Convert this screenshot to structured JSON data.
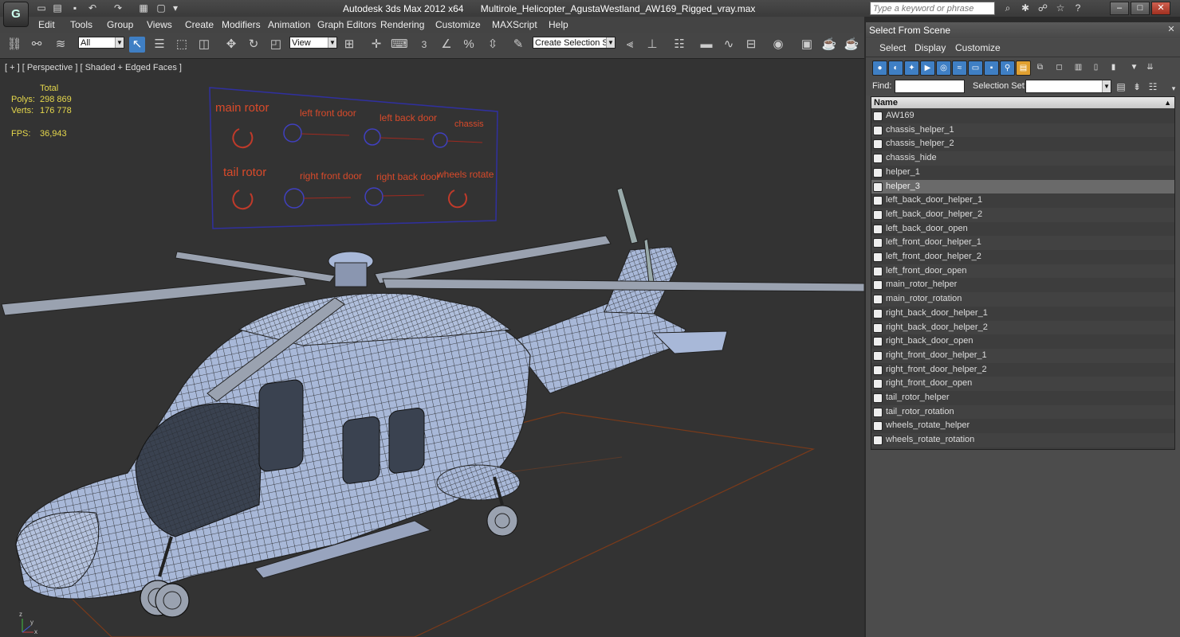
{
  "app": {
    "title": "Autodesk 3ds Max  2012 x64",
    "file": "Multirole_Helicopter_AgustaWestland_AW169_Rigged_vray.max",
    "logo_glyph": "G",
    "search_placeholder": "Type a keyword or phrase"
  },
  "menu": [
    "Edit",
    "Tools",
    "Group",
    "Views",
    "Create",
    "Modifiers",
    "Animation",
    "Graph Editors",
    "Rendering",
    "Customize",
    "MAXScript",
    "Help"
  ],
  "toolbar": {
    "filter_value": "All",
    "refcoord_value": "View",
    "selset_value": "Create Selection Se",
    "snap_label": "3"
  },
  "viewport": {
    "label": "[ + ] [ Perspective ] [ Shaded + Edged Faces ]",
    "stats": {
      "total_label": "Total",
      "polys_label": "Polys:",
      "polys_value": "298 869",
      "verts_label": "Verts:",
      "verts_value": "176 778",
      "fps_label": "FPS:",
      "fps_value": "36,943"
    },
    "control_board": {
      "main_rotor": "main rotor",
      "left_front_door": "left front door",
      "left_back_door": "left back door",
      "chassis": "chassis",
      "tail_rotor": "tail rotor",
      "right_front_door": "right front door",
      "right_back_door": "right back door",
      "wheels_rotate": "wheels rotate"
    },
    "axis": {
      "x": "x",
      "y": "y",
      "z": "z"
    }
  },
  "scene_explorer": {
    "title": "Select From Scene",
    "menu": [
      "Select",
      "Display",
      "Customize"
    ],
    "find_label": "Find:",
    "selection_set_label": "Selection Set:",
    "column_header": "Name",
    "selected_index": 5,
    "items": [
      "AW169",
      "chassis_helper_1",
      "chassis_helper_2",
      "chassis_hide",
      "helper_1",
      "helper_3",
      "left_back_door_helper_1",
      "left_back_door_helper_2",
      "left_back_door_open",
      "left_front_door_helper_1",
      "left_front_door_helper_2",
      "left_front_door_open",
      "main_rotor_helper",
      "main_rotor_rotation",
      "right_back_door_helper_1",
      "right_back_door_helper_2",
      "right_back_door_open",
      "right_front_door_helper_1",
      "right_front_door_helper_2",
      "right_front_door_open",
      "tail_rotor_helper",
      "tail_rotor_rotation",
      "wheels_rotate_helper",
      "wheels_rotate_rotation"
    ]
  },
  "colors": {
    "accent": "#3f7fc4",
    "stats_text": "#e6d84c",
    "board_text": "#d94a2a",
    "board_frame": "#3030a0",
    "mesh": "#a8b8d8",
    "wire": "#1a1a1a"
  }
}
